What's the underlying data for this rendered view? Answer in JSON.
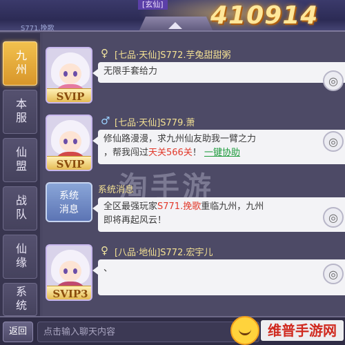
{
  "header": {
    "realm_tag": "[玄仙]",
    "score": "410914",
    "blurb": "S771.挽歌"
  },
  "tabs": [
    "九州",
    "本服",
    "仙盟",
    "战队",
    "仙缘",
    "系统"
  ],
  "active_tab": 0,
  "messages": [
    {
      "gender": "♀",
      "name": "[七品·天仙]S772.芋兔甜甜粥",
      "svip": "SVIP",
      "text": "无限手套给力"
    },
    {
      "gender": "♂",
      "name": "[七品·天仙]S779.萧",
      "svip": "SVIP",
      "text_1": "修仙路漫漫，求九州仙友助我一臂之力",
      "text_2a": "，帮我闯过",
      "text_2_red": "天关566关",
      "text_2b": "！",
      "text_2_link": "一键协助"
    },
    {
      "badge": "系统消息",
      "badge_line1": "系统",
      "badge_line2": "消息",
      "title": "系统消息",
      "text_1a": "全区最强玩家",
      "text_1_red": "S771.挽歌",
      "text_1b": "重临九州，九州",
      "text_2": "即将再起风云！"
    },
    {
      "gender": "♀",
      "name": "[八品·地仙]S772.宏宇儿",
      "svip": "SVIP3",
      "text": "、"
    }
  ],
  "bottom": {
    "back_label": "返回",
    "input_placeholder": "点击输入聊天内容"
  },
  "watermark": {
    "center": "淘手游",
    "corner": "维普手游网"
  },
  "colors": {
    "accent": "#f2c14e",
    "name": "#f3e093",
    "highlight": "#e2392b",
    "link": "#1d9b3c"
  }
}
